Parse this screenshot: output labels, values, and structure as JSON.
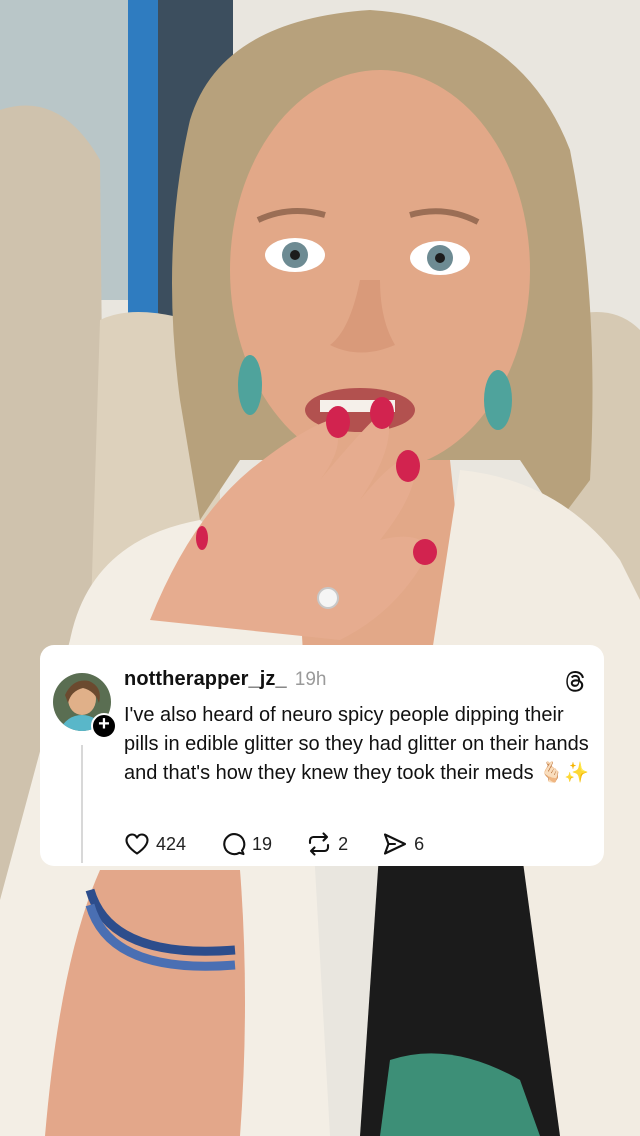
{
  "post": {
    "username": "nottherapper_jz_",
    "timestamp": "19h",
    "text": "I've also heard of neuro spicy people dipping their pills in edible glitter so they had glitter on their hands and that's how they knew they took their meds 🫰🏻✨",
    "follow_badge": "+",
    "stats": {
      "likes": "424",
      "replies": "19",
      "reposts": "2",
      "shares": "6"
    }
  },
  "icons": {
    "like": "heart-icon",
    "reply": "comment-icon",
    "repost": "repost-icon",
    "share": "send-icon",
    "brand": "threads-logo-icon"
  },
  "colors": {
    "card_background": "#ffffff",
    "text": "#111111",
    "timestamp": "#9a9a9a",
    "nail_polish": "#d2234f"
  }
}
